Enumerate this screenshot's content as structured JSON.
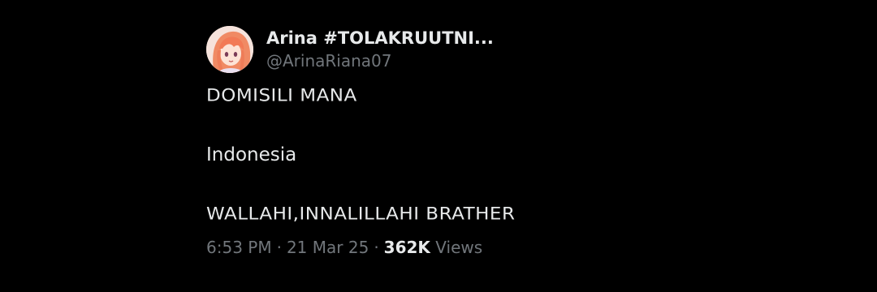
{
  "author": {
    "display_name": "Arina #TOLAKRUUTNI...",
    "handle": "@ArinaRiana07",
    "avatar_icon": "anime-avatar-icon"
  },
  "tweet": {
    "lines": [
      "DOMISILI MANA",
      "Indonesia",
      "WALLAHI,INNALILLAHI BRATHER"
    ]
  },
  "meta": {
    "time": "6:53 PM",
    "separator": "·",
    "date": "21 Mar 25",
    "views_count": "362K",
    "views_label": "Views"
  },
  "colors": {
    "background": "#000000",
    "primary_text": "#e7e9ea",
    "secondary_text": "#71767b"
  }
}
